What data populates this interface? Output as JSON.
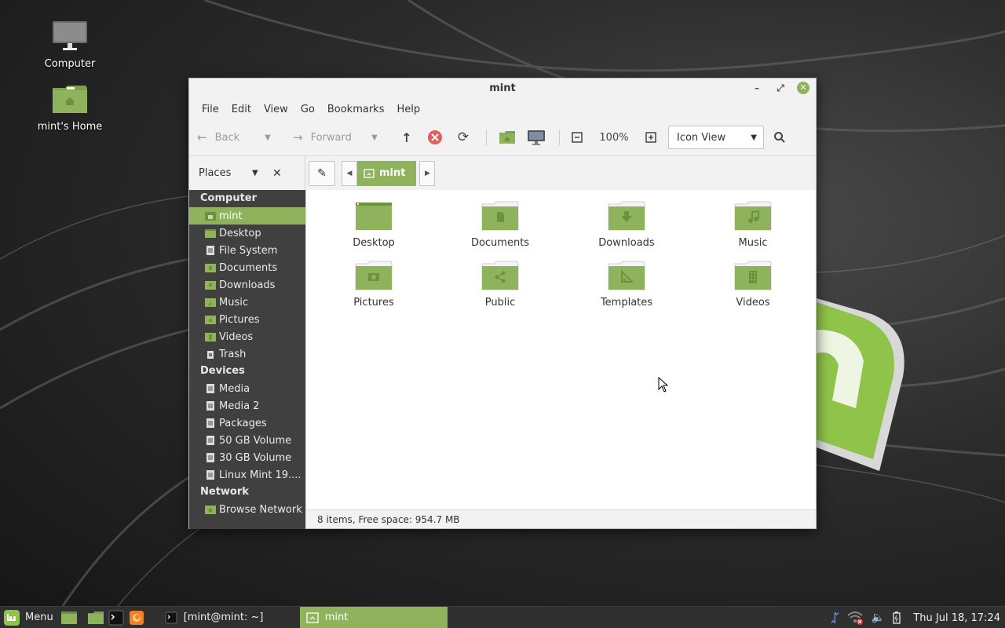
{
  "desktop": {
    "icons": [
      {
        "label": "Computer",
        "icon": "monitor-icon"
      },
      {
        "label": "mint's Home",
        "icon": "home-folder-icon"
      }
    ]
  },
  "window": {
    "title": "mint",
    "menu": [
      "File",
      "Edit",
      "View",
      "Go",
      "Bookmarks",
      "Help"
    ],
    "toolbar": {
      "back_label": "Back",
      "forward_label": "Forward",
      "zoom_level": "100%",
      "view_mode": "Icon View"
    },
    "places": {
      "label": "Places"
    },
    "breadcrumb": {
      "current": "mint"
    },
    "sidebar": {
      "sections": [
        {
          "title": "Computer",
          "items": [
            "mint",
            "Desktop",
            "File System",
            "Documents",
            "Downloads",
            "Music",
            "Pictures",
            "Videos",
            "Trash"
          ]
        },
        {
          "title": "Devices",
          "items": [
            "Media",
            "Media 2",
            "Packages",
            "50 GB Volume",
            "30 GB Volume",
            "Linux Mint 19...."
          ]
        },
        {
          "title": "Network",
          "items": [
            "Browse Network"
          ]
        }
      ],
      "selected": "mint"
    },
    "files": [
      {
        "name": "Desktop",
        "icon": "desktop-folder-icon"
      },
      {
        "name": "Documents",
        "icon": "documents-folder-icon"
      },
      {
        "name": "Downloads",
        "icon": "downloads-folder-icon"
      },
      {
        "name": "Music",
        "icon": "music-folder-icon"
      },
      {
        "name": "Pictures",
        "icon": "pictures-folder-icon"
      },
      {
        "name": "Public",
        "icon": "public-folder-icon"
      },
      {
        "name": "Templates",
        "icon": "templates-folder-icon"
      },
      {
        "name": "Videos",
        "icon": "videos-folder-icon"
      }
    ],
    "status": "8 items, Free space: 954.7 MB"
  },
  "taskbar": {
    "menu_label": "Menu",
    "tasks": [
      {
        "label": "[mint@mint: ~]",
        "active": false
      },
      {
        "label": "mint",
        "active": true
      }
    ],
    "clock": "Thu Jul 18, 17:24"
  },
  "colors": {
    "accent": "#8fb35d",
    "sidebar": "#404040",
    "taskbar": "#2f2f2f"
  }
}
